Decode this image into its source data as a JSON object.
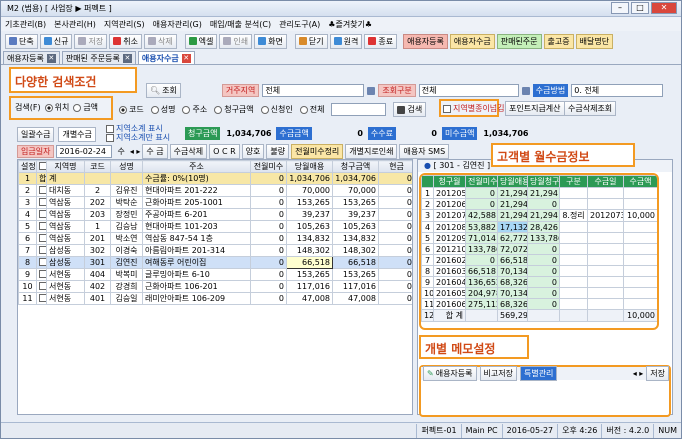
{
  "title": "M2 (범용) [ 사업장 ▶ 퍼펙트 ]",
  "menu": [
    "기초관리(B)",
    "본사관리(H)",
    "지역관리(S)",
    "애용자관리(G)",
    "매입/매출 분석(C)",
    "관리도구(A)",
    "♣즐겨찾기♣"
  ],
  "toolbar": [
    "단축",
    "신규",
    "저장",
    "취소",
    "삭제",
    "엑셀",
    "인쇄",
    "화면",
    "닫기",
    "원격",
    "종료",
    "애용자등록",
    "애용자수금",
    "판매된주문",
    "출고증",
    "배달명단"
  ],
  "tabs": [
    "애용자등록",
    "판매된 주문등록",
    "애용자수금"
  ],
  "callouts": {
    "search": "다양한 검색조건",
    "monthly": "고객별 월수금정보",
    "memo": "개별 메모설정"
  },
  "search": {
    "query_btn": "조회",
    "guarantor_label": "거주지역",
    "guarantor_value": "전체",
    "query_type_label": "조회구분",
    "query_type_value": "전체",
    "method_label": "수금방법",
    "method_value": "0. 전체",
    "search_label": "검색(F)",
    "pos": "위치",
    "amount": "금액",
    "code": "코드",
    "name": "성명",
    "address": "주소",
    "billing": "청구금액",
    "newdate": "신청인",
    "all": "전체",
    "search_btn": "검색",
    "single_print": "지역별종이넘김",
    "point_calc": "포인트지급계산",
    "delete_query": "수금삭제조회"
  },
  "sub": {
    "tab1": "일괄수금",
    "tab2": "개별수금",
    "chk1": "지역소계 표시",
    "chk2": "지역소계만 표시",
    "billing_lbl": "청구금액",
    "billing_val": "1,034,706",
    "collected_lbl": "수금금액",
    "collected_val": "0",
    "fee_lbl": "수수료",
    "fee_val": "0",
    "unpaid_lbl": "미수금액",
    "unpaid_val": "1,034,706"
  },
  "dateRow": {
    "label": "입금일자",
    "date": "2016-02-24",
    "day": "수",
    "buttons": [
      "수 금",
      "수금삭제",
      "O C R",
      "양호",
      "불량",
      "전월미수정리",
      "개별지로인쇄",
      "애용자 SMS"
    ]
  },
  "left": {
    "headers": [
      "설정",
      "",
      "지역명",
      "코드",
      "성명",
      "주소",
      "전월미수",
      "당월애용",
      "청구금액",
      "현금"
    ],
    "rows": [
      [
        "1",
        "합",
        "계",
        "",
        "",
        "수금률: 0%(10명)",
        "0",
        "1,034,706",
        "1,034,706",
        "0"
      ],
      [
        "2",
        "",
        "대치동",
        "2",
        "김유진",
        "현대아파트 201-222",
        "0",
        "70,000",
        "70,000",
        "0"
      ],
      [
        "3",
        "",
        "역삼동",
        "202",
        "박탁순",
        "근화아파트 205-1001",
        "0",
        "153,265",
        "153,265",
        "0"
      ],
      [
        "4",
        "",
        "역삼동",
        "203",
        "장정민",
        "주공아파트 6-201",
        "0",
        "39,237",
        "39,237",
        "0"
      ],
      [
        "5",
        "",
        "역삼동",
        "1",
        "김승남",
        "현대아파트 101-203",
        "0",
        "105,263",
        "105,263",
        "0"
      ],
      [
        "6",
        "",
        "역삼동",
        "201",
        "박소연",
        "역삼동 847-54 1층",
        "0",
        "134,832",
        "134,832",
        "0"
      ],
      [
        "7",
        "",
        "삼성동",
        "302",
        "이경숙",
        "아름림아파트 201-314",
        "0",
        "148,302",
        "148,302",
        "0"
      ],
      [
        "8",
        "",
        "삼성동",
        "301",
        "김연진",
        "여해동루 어린이집",
        "0",
        "66,518",
        "66,518",
        "0"
      ],
      [
        "9",
        "",
        "서현동",
        "404",
        "박복미",
        "글루밍아파트 6-10",
        "0",
        "153,265",
        "153,265",
        "0"
      ],
      [
        "10",
        "",
        "서현동",
        "402",
        "강경희",
        "근화아파트 106-201",
        "0",
        "117,016",
        "117,016",
        "0"
      ],
      [
        "11",
        "",
        "서현동",
        "401",
        "김승일",
        "래미안아파트 106-209",
        "0",
        "47,008",
        "47,008",
        "0"
      ]
    ]
  },
  "right": {
    "title": "[ 301 - 김연진 ]",
    "headers": [
      "청구월",
      "전월미수",
      "당월애용",
      "당월청구",
      "구분",
      "수금일",
      "수금액"
    ],
    "rows": [
      [
        "1",
        "201205",
        "0",
        "21,294",
        "21,294",
        "",
        "",
        ""
      ],
      [
        "2",
        "201206",
        "0",
        "21,294",
        "0",
        "",
        "",
        ""
      ],
      [
        "3",
        "201207",
        "42,588",
        "21,294",
        "21,294",
        "8.정리",
        "20120731",
        "10,000"
      ],
      [
        "4",
        "201208",
        "53,882",
        "17,132",
        "28,426",
        "",
        "",
        ""
      ],
      [
        "5",
        "201209",
        "71,014",
        "62,772",
        "133,786",
        "",
        "",
        ""
      ],
      [
        "6",
        "201210",
        "133,786",
        "72,072",
        "0",
        "",
        "",
        ""
      ],
      [
        "7",
        "201602",
        "0",
        "66,518",
        "0",
        "",
        "",
        ""
      ],
      [
        "8",
        "201603",
        "66,518",
        "70,134",
        "0",
        "",
        "",
        ""
      ],
      [
        "9",
        "201604",
        "136,652",
        "68,326",
        "0",
        "",
        "",
        ""
      ],
      [
        "10",
        "201605",
        "204,978",
        "70,134",
        "0",
        "",
        "",
        ""
      ],
      [
        "11",
        "201606",
        "275,112",
        "68,326",
        "0",
        "",
        "",
        ""
      ],
      [
        "12",
        "합 계",
        "",
        "569,296",
        "",
        "",
        "",
        "10,000"
      ]
    ]
  },
  "memo": {
    "tab1": "애용자등록",
    "tab2": "비고저장",
    "tab3": "특별관리",
    "save": "저장"
  },
  "status": [
    "퍼펙트-01",
    "Main PC",
    "2016-05-27",
    "오후 4:26",
    "버전 : 4.2.0",
    "NUM"
  ]
}
